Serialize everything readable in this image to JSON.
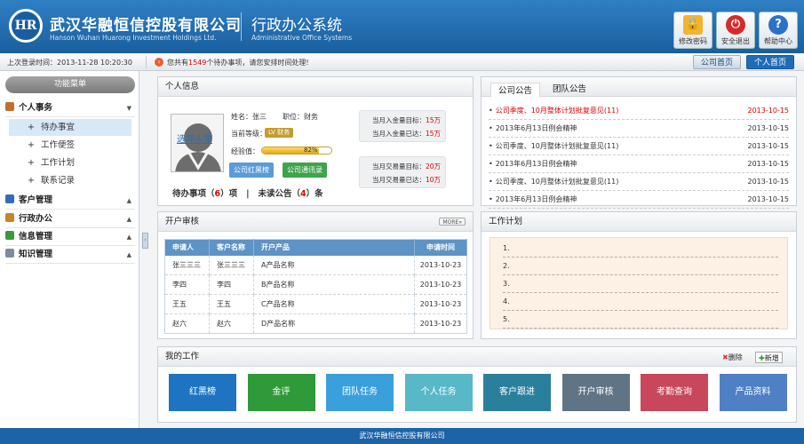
{
  "header": {
    "logo": "HR",
    "company_cn": "武汉华融恒信控股有限公司",
    "company_en": "Hanson Wuhan Huarong Investment Holdings Ltd.",
    "system_cn": "行政办公系统",
    "system_en": "Administrative Office Systems",
    "buttons": [
      {
        "label": "修改密码",
        "icon": "lock-icon",
        "color": "#f2b431"
      },
      {
        "label": "安全退出",
        "icon": "power-icon",
        "color": "#d62a2a"
      },
      {
        "label": "帮助中心",
        "icon": "help-icon",
        "color": "#2a72c8"
      }
    ]
  },
  "topbar": {
    "last_login": "上次登录时间：2013-11-28 10:20:30",
    "notice_prefix": "您共有",
    "notice_count": "1549",
    "notice_suffix": "个待办事项，请您安排时间处理!",
    "company_home": "公司首页",
    "personal_home": "个人首页"
  },
  "sidebar": {
    "title": "功能菜单",
    "groups": [
      {
        "label": "个人事务",
        "icon": "clipboard-icon",
        "color": "#c0702e",
        "arrow": "▼"
      },
      {
        "label": "客户管理",
        "icon": "book-icon",
        "color": "#2f6fb8",
        "arrow": "▲"
      },
      {
        "label": "行政办公",
        "icon": "briefcase-icon",
        "color": "#c9822b",
        "arrow": "▲"
      },
      {
        "label": "信息管理",
        "icon": "checkbox-icon",
        "color": "#3a9a3a",
        "arrow": "▲"
      },
      {
        "label": "知识管理",
        "icon": "note-icon",
        "color": "#7b8da3",
        "arrow": "▲"
      }
    ],
    "sub_items": [
      "待办事宜",
      "工作便签",
      "工作计划",
      "联系记录"
    ]
  },
  "profile": {
    "title": "个人信息",
    "avatar_label": "选择头像",
    "name": "姓名：张三",
    "position": "职位：财务",
    "level_label": "当前等级：",
    "level_badge": "LV 财务",
    "exp_label": "经验值：",
    "exp_percent": 82,
    "exp_text": "82%",
    "btn_rank": "公司红黑榜",
    "btn_contacts": "公司通讯录",
    "todo_prefix": "待办事项（",
    "todo_count": "6",
    "todo_suffix": "）项",
    "sep": "|",
    "unread_prefix": "未读公告（",
    "unread_count": "4",
    "unread_suffix": "）条",
    "stats": [
      {
        "label": "当月入金量目标：",
        "value": "15万"
      },
      {
        "label": "当月入金量已达：",
        "value": "15万"
      },
      {
        "label": "当月交易量目标：",
        "value": "20万"
      },
      {
        "label": "当月交易量已达：",
        "value": "10万"
      }
    ]
  },
  "notices": {
    "tab_company": "公司公告",
    "tab_team": "团队公告",
    "rows": [
      {
        "text": "公司季度、10月整体计划批复意见(11)",
        "date": "2013-10-15",
        "hot": true
      },
      {
        "text": "2013年6月13日例会精神",
        "date": "2013-10-15",
        "hot": false
      },
      {
        "text": "公司季度、10月整体计划批复意见(11)",
        "date": "2013-10-15",
        "hot": false
      },
      {
        "text": "2013年6月13日例会精神",
        "date": "2013-10-15",
        "hot": false
      },
      {
        "text": "公司季度、10月整体计划批复意见(11)",
        "date": "2013-10-15",
        "hot": false
      },
      {
        "text": "2013年6月13日例会精神",
        "date": "2013-10-15",
        "hot": false
      }
    ]
  },
  "audit": {
    "title": "开户审核",
    "more": "MORE»",
    "headers": [
      "申请人",
      "客户名称",
      "开户产品",
      "申请时间"
    ],
    "rows": [
      [
        "张三三三",
        "张三三三",
        "A产品名称",
        "2013-10-23"
      ],
      [
        "李四",
        "李四",
        "B产品名称",
        "2013-10-23"
      ],
      [
        "王五",
        "王五",
        "C产品名称",
        "2013-10-23"
      ],
      [
        "赵六",
        "赵六",
        "D产品名称",
        "2013-10-23"
      ]
    ]
  },
  "plan": {
    "title": "工作计划",
    "lines": [
      "1.",
      "2.",
      "3.",
      "4.",
      "5."
    ]
  },
  "mywork": {
    "title": "我的工作",
    "delete": "删除",
    "add": "新增",
    "tiles": [
      {
        "label": "红黑榜",
        "color": "#1f74c2"
      },
      {
        "label": "金评",
        "color": "#2f9a3a"
      },
      {
        "label": "团队任务",
        "color": "#3aa0dc"
      },
      {
        "label": "个人任务",
        "color": "#58b8c8"
      },
      {
        "label": "客户跟进",
        "color": "#2a7f9c"
      },
      {
        "label": "开户审核",
        "color": "#5f7585"
      },
      {
        "label": "考勤查询",
        "color": "#c8475a"
      },
      {
        "label": "产品资料",
        "color": "#4f7fc4"
      }
    ]
  },
  "footer": {
    "text": "武汉华融恒信控股有限公司"
  }
}
